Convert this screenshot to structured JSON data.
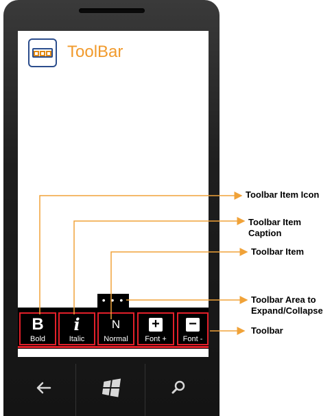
{
  "app": {
    "title": "ToolBar"
  },
  "expand_tab": {
    "label": "• • •"
  },
  "toolbar": {
    "items": [
      {
        "glyph": "B",
        "caption": "Bold"
      },
      {
        "glyph": "i",
        "caption": "Italic"
      },
      {
        "glyph": "N",
        "caption": "Normal"
      },
      {
        "glyph": "+",
        "caption": "Font +"
      },
      {
        "glyph": "−",
        "caption": "Font -"
      }
    ]
  },
  "nav": {
    "back_icon": "back-arrow-icon",
    "start_icon": "windows-logo-icon",
    "search_icon": "search-icon"
  },
  "callouts": {
    "item_icon": "Toolbar Item Icon",
    "item_caption": "Toolbar Item Caption",
    "item": "Toolbar Item",
    "expand_area": "Toolbar Area to Expand/Collapse",
    "toolbar": "Toolbar"
  },
  "colors": {
    "accent": "#f19a2c",
    "border": "#e3202a",
    "callout_line": "#f0a238"
  }
}
